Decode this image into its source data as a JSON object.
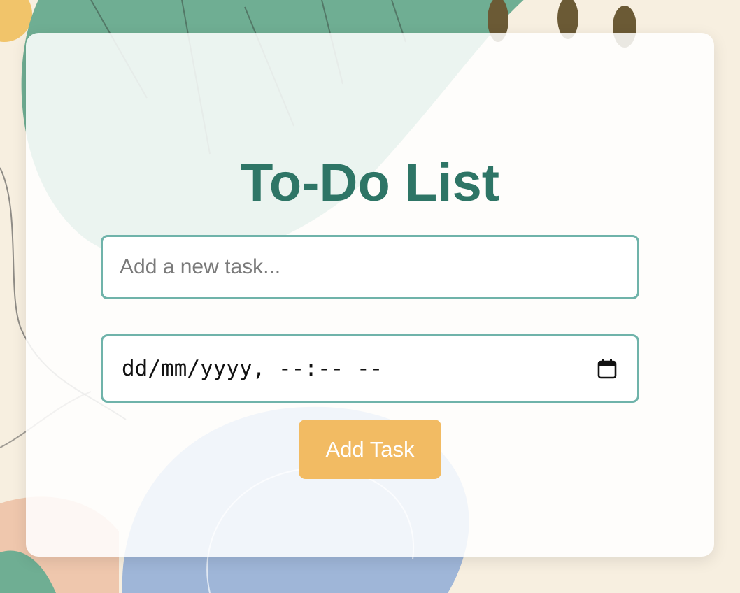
{
  "app": {
    "title": "To-Do List"
  },
  "task_input": {
    "placeholder": "Add a new task...",
    "value": ""
  },
  "datetime_input": {
    "display_value": "dd/mm/yyyy, --:-- --",
    "icon": "calendar-icon"
  },
  "add_button": {
    "label": "Add Task"
  },
  "colors": {
    "title": "#2e7566",
    "input_border": "#6fb3aa",
    "button_background": "#f2bb63",
    "button_text": "#ffffff",
    "page_background": "#f7efe0"
  }
}
